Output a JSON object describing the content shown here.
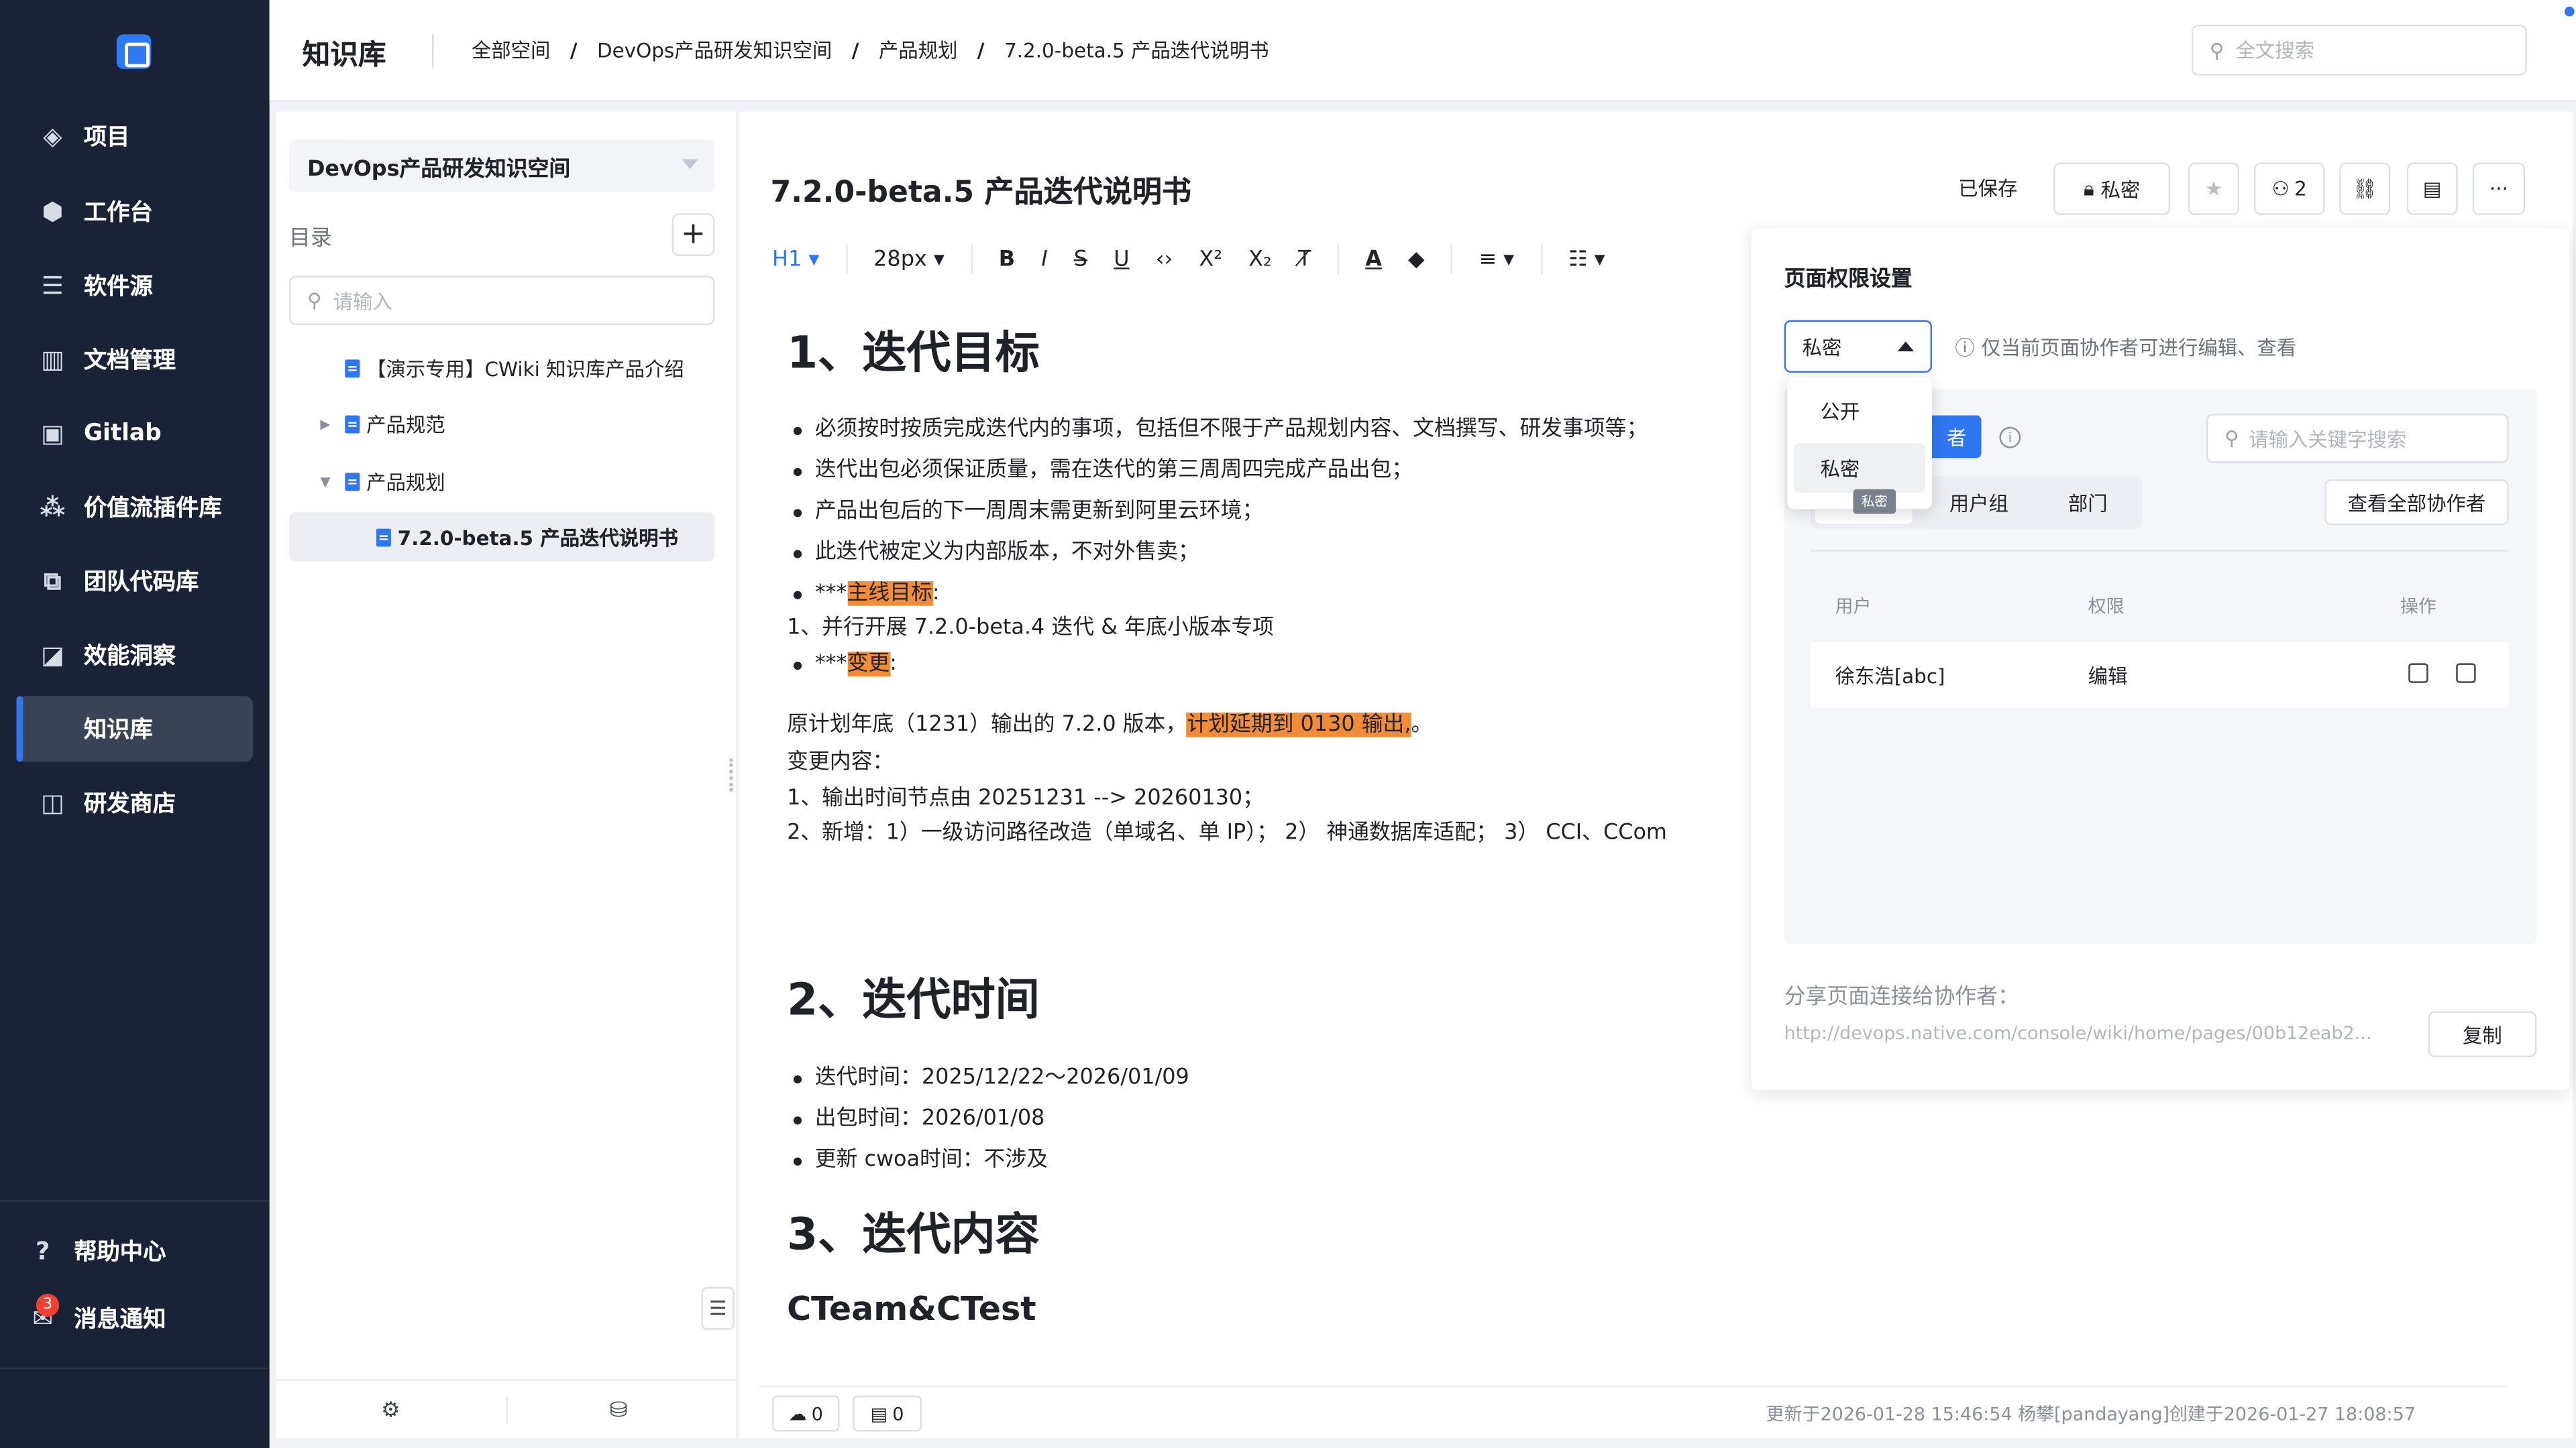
{
  "nav": {
    "items": [
      {
        "label": "项目",
        "icon": "layers-icon"
      },
      {
        "label": "工作台",
        "icon": "cube-icon"
      },
      {
        "label": "软件源",
        "icon": "server-icon"
      },
      {
        "label": "文档管理",
        "icon": "docs-bar-icon"
      },
      {
        "label": "Gitlab",
        "icon": "terminal-icon"
      },
      {
        "label": "价值流插件库",
        "icon": "plugin-icon"
      },
      {
        "label": "团队代码库",
        "icon": "code-icon"
      },
      {
        "label": "效能洞察",
        "icon": "chart-icon"
      },
      {
        "label": "知识库",
        "icon": "book-icon"
      },
      {
        "label": "研发商店",
        "icon": "bag-icon"
      }
    ],
    "active_index": 8,
    "help": "帮助中心",
    "notify": "消息通知",
    "notify_badge": "3"
  },
  "header": {
    "title": "知识库",
    "breadcrumbs": [
      "全部空间",
      "DevOps产品研发知识空间",
      "产品规划",
      "7.2.0-beta.5 产品迭代说明书"
    ],
    "search_placeholder": "全文搜索"
  },
  "tree": {
    "space": "DevOps产品研发知识空间",
    "toc_label": "目录",
    "add": "+",
    "search_placeholder": "请输入",
    "nodes": [
      {
        "label": "【演示专用】CWiki 知识库产品介绍"
      },
      {
        "label": "产品规范"
      },
      {
        "label": "产品规划"
      },
      {
        "label": "7.2.0-beta.5 产品迭代说明书"
      }
    ]
  },
  "editor": {
    "title": "7.2.0-beta.5 产品迭代说明书",
    "saved": "已保存",
    "private_label": "私密",
    "collab_count": "2",
    "toolbar": {
      "heading": "H1",
      "size": "28px",
      "bold": "B",
      "italic": "I",
      "strike": "S",
      "underline": "U",
      "code": "‹›",
      "sup": "X²",
      "sub": "X₂",
      "clear": "T̸"
    },
    "h_goal": "1、迭代目标",
    "goal_items": [
      "必须按时按质完成迭代内的事项，包括但不限于产品规划内容、文档撰写、研发事项等；",
      "迭代出包必须保证质量，需在迭代的第三周周四完成产品出包；",
      "产品出包后的下一周周末需更新到阿里云环境；",
      "此迭代被定义为内部版本，不对外售卖；"
    ],
    "main_goal_prefix": "***",
    "main_goal": "主线目标",
    "colon": ":",
    "main_goal_detail": "1、并行开展 7.2.0-beta.4 迭代 &  年底小版本专项",
    "change_prefix": "***",
    "change": "变更",
    "plan_text": "原计划年底（1231）输出的 7.2.0 版本，",
    "plan_delay": "计划延期到 0130 输出,",
    "plan_end": "。",
    "change_content": "变更内容：",
    "change_1": "1、输出时间节点由 20251231 --> 20260130；",
    "change_2": "2、新增：1）一级访问路径改造（单域名、单 IP）；  2） 神通数据库适配；  3） CCI、CCom",
    "h_time": "2、迭代时间",
    "time_items": [
      "迭代时间：2025/12/22～2026/01/09",
      "出包时间：2026/01/08",
      "更新 cwoa时间：不涉及"
    ],
    "h_content": "3、迭代内容",
    "h_cteam": "CTeam&CTest",
    "upload_count": "0",
    "comment_count": "0",
    "meta": "更新于2026-01-28 15:46:54  杨攀[pandayang]创建于2026-01-27 18:08:57"
  },
  "permission": {
    "title": "页面权限设置",
    "selected": "私密",
    "hint": "仅当前页面协作者可进行编辑、查看",
    "options": [
      "公开",
      "私密"
    ],
    "tooltip": "私密",
    "add_collab_partial": "者",
    "keyword_placeholder": "请输入关键字搜索",
    "tabs": [
      "用户",
      "用户组",
      "部门"
    ],
    "tab_partial": "用",
    "view_all": "查看全部协作者",
    "columns": [
      "用户",
      "权限",
      "操作"
    ],
    "rows": [
      {
        "user": "徐东浩[abc]",
        "perm": "编辑"
      }
    ],
    "share_label": "分享页面连接给协作者：",
    "share_url": "http://devops.native.com/console/wiki/home/pages/00b12eab2...",
    "copy": "复制"
  }
}
